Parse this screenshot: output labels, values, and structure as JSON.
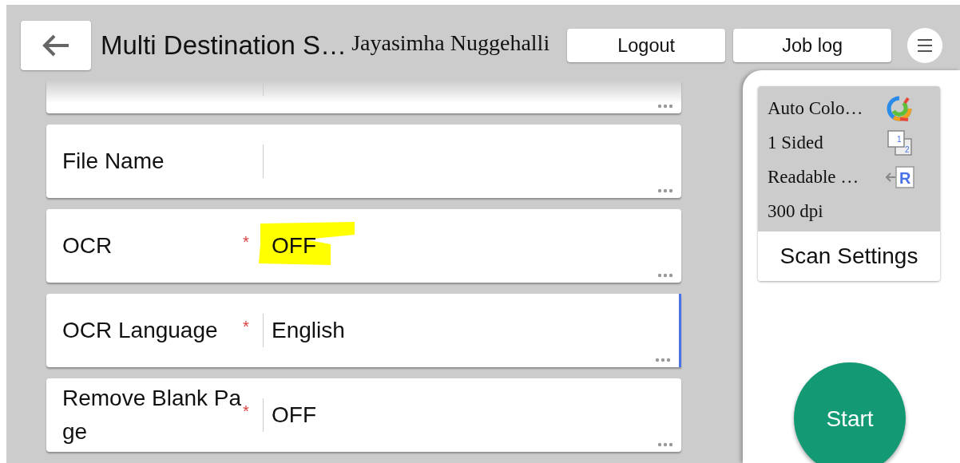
{
  "header": {
    "title": "Multi Destination S…",
    "user": "Jayasimha Nuggehalli",
    "buttons": [
      "Logout",
      "Job log"
    ]
  },
  "settings": [
    {
      "label": "File Name",
      "highlighted": false,
      "selected": false
    },
    {
      "label": "OCR",
      "required_mark": "*",
      "value": "OFF",
      "highlighted": true,
      "selected": false
    },
    {
      "label": "OCR Language",
      "required_mark": "*",
      "value": "English",
      "highlighted": false,
      "selected": true
    },
    {
      "label": "Remove Blank Page",
      "required_mark": "*",
      "value": "OFF",
      "highlighted": false,
      "selected": false
    }
  ],
  "scan_summary": {
    "items": [
      {
        "text": "Auto Colo…",
        "kind": "color"
      },
      {
        "text": "1 Sided",
        "kind": "sides",
        "icon_text": [
          "1",
          "2"
        ]
      },
      {
        "text": "Readable …",
        "kind": "orientation",
        "icon_text": [
          "R"
        ]
      },
      {
        "text": "300 dpi",
        "kind": "plain"
      }
    ],
    "button": "Scan Settings"
  },
  "start_button": "Start"
}
